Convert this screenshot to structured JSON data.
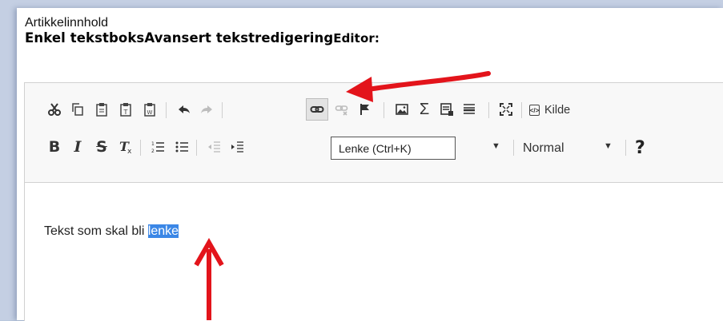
{
  "form": {
    "field_label": "Artikkelinnhold",
    "tab_simple": "Enkel tekstboks",
    "tab_advanced": "Avansert tekstredigering",
    "editor_label": "Editor:"
  },
  "toolbar": {
    "row1": [
      {
        "name": "cut-button",
        "glyph": "✂"
      },
      {
        "name": "copy-button",
        "glyph": "⎘"
      },
      {
        "name": "paste-button",
        "glyph": "📋"
      },
      {
        "name": "paste-text-button",
        "glyph": "📋"
      },
      {
        "name": "paste-word-button",
        "glyph": "📋"
      },
      {
        "name": "undo-button",
        "glyph": "⬅"
      },
      {
        "name": "redo-button",
        "glyph": "➡"
      },
      {
        "name": "link-button",
        "glyph": "🔗"
      },
      {
        "name": "unlink-button",
        "glyph": "⛓"
      },
      {
        "name": "anchor-button",
        "glyph": "⚑"
      },
      {
        "name": "image-button",
        "glyph": "🖼"
      },
      {
        "name": "math-button",
        "glyph": "Σ"
      },
      {
        "name": "iframe-button",
        "glyph": "▤"
      },
      {
        "name": "horizontal-rule-button",
        "glyph": "☰"
      },
      {
        "name": "maximize-button",
        "glyph": "⛶"
      }
    ],
    "source_label": "Kilde",
    "tooltip": "Lenke (Ctrl+K)",
    "format_value": "Normal",
    "help_label": "?",
    "bold_label": "B",
    "italic_label": "I",
    "strike_label": "S",
    "clear_format_label": "Tx",
    "ordered_list_glyph": "1≡",
    "bullet_list_glyph": "•≡",
    "outdent_glyph": "⇤",
    "indent_glyph": "⇥"
  },
  "content": {
    "text_before": "Tekst som skal bli ",
    "selected_text": "lenke"
  },
  "colors": {
    "selection": "#3b87e6",
    "arrow": "#e3141b"
  }
}
